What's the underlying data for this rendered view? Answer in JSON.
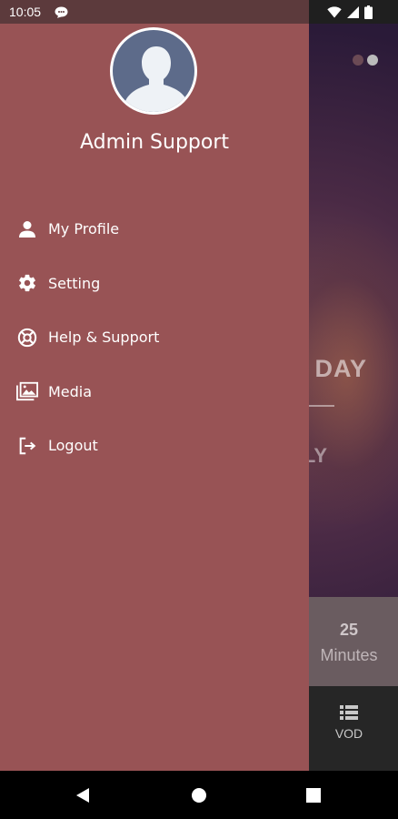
{
  "status_bar": {
    "time": "10:05"
  },
  "drawer": {
    "user_name": "Admin Support",
    "menu": [
      {
        "label": "My Profile",
        "icon": "person-icon"
      },
      {
        "label": "Setting",
        "icon": "gear-icon"
      },
      {
        "label": "Help & Support",
        "icon": "lifebuoy-icon"
      },
      {
        "label": "Media",
        "icon": "photo-library-icon"
      },
      {
        "label": "Logout",
        "icon": "logout-icon"
      }
    ]
  },
  "background": {
    "headline": "DAY",
    "subline": "LY",
    "stat_value": "25",
    "stat_label": "Minutes",
    "nav_label": "VOD",
    "carousel_active_index": 1
  },
  "colors": {
    "drawer": "#985355",
    "status_bar": "#5c3a3c",
    "text": "#ffffff"
  }
}
